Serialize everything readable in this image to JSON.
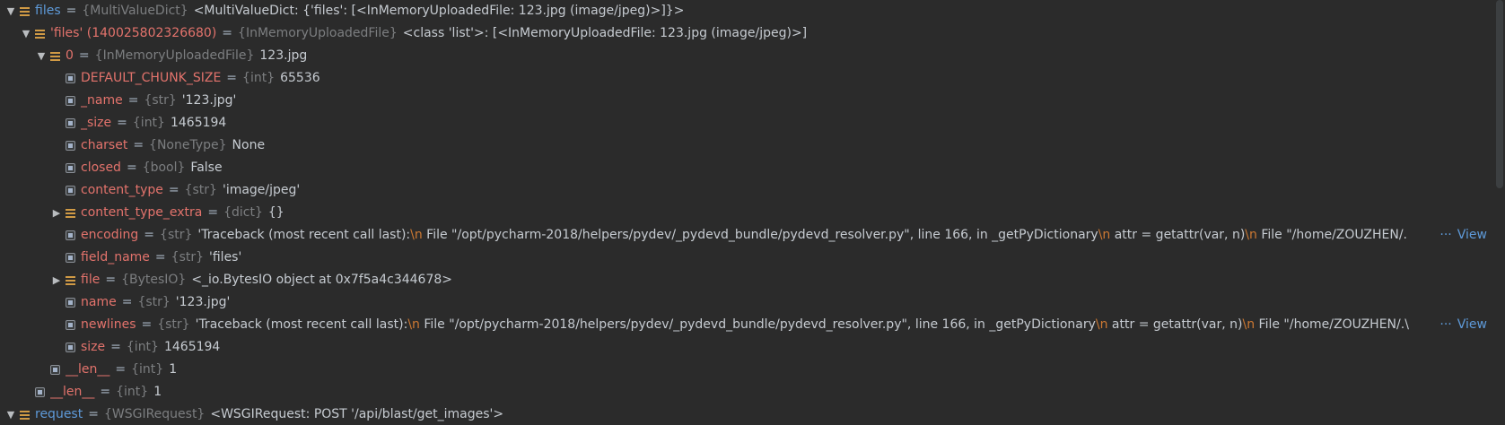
{
  "rows": [
    {
      "level": 0,
      "expanded": "open",
      "icon": "obj",
      "name": "files",
      "top": true,
      "type": "{MultiValueDict}",
      "value": "<MultiValueDict: {'files': [<InMemoryUploadedFile: 123.jpg (image/jpeg)>]}>"
    },
    {
      "level": 1,
      "expanded": "open",
      "icon": "obj",
      "name": "'files' (140025802326680)",
      "top": false,
      "type": "{InMemoryUploadedFile}",
      "value": "<class 'list'>: [<InMemoryUploadedFile: 123.jpg (image/jpeg)>]"
    },
    {
      "level": 2,
      "expanded": "open",
      "icon": "obj",
      "name": "0",
      "top": false,
      "type": "{InMemoryUploadedFile}",
      "value": "123.jpg"
    },
    {
      "level": 3,
      "expanded": "none",
      "icon": "prim",
      "name": "DEFAULT_CHUNK_SIZE",
      "top": false,
      "type": "{int}",
      "value": "65536"
    },
    {
      "level": 3,
      "expanded": "none",
      "icon": "prim",
      "name": "_name",
      "top": false,
      "type": "{str}",
      "value": "'123.jpg'"
    },
    {
      "level": 3,
      "expanded": "none",
      "icon": "prim",
      "name": "_size",
      "top": false,
      "type": "{int}",
      "value": "1465194"
    },
    {
      "level": 3,
      "expanded": "none",
      "icon": "prim",
      "name": "charset",
      "top": false,
      "type": "{NoneType}",
      "value": "None"
    },
    {
      "level": 3,
      "expanded": "none",
      "icon": "prim",
      "name": "closed",
      "top": false,
      "type": "{bool}",
      "value": "False"
    },
    {
      "level": 3,
      "expanded": "none",
      "icon": "prim",
      "name": "content_type",
      "top": false,
      "type": "{str}",
      "value": "'image/jpeg'"
    },
    {
      "level": 3,
      "expanded": "closed",
      "icon": "obj",
      "name": "content_type_extra",
      "top": false,
      "type": "{dict}",
      "value": "{}"
    },
    {
      "level": 3,
      "expanded": "none",
      "icon": "prim",
      "name": "encoding",
      "top": false,
      "type": "{str}",
      "value_parts": [
        "'Traceback (most recent call last):",
        "\\n",
        "  File \"/opt/pycharm-2018/helpers/pydev/_pydevd_bundle/pydevd_resolver.py\", line 166, in _getPyDictionary",
        "\\n",
        "    attr = getattr(var, n)",
        "\\n",
        "  File \"/home/ZOUZHEN/."
      ],
      "more": true
    },
    {
      "level": 3,
      "expanded": "none",
      "icon": "prim",
      "name": "field_name",
      "top": false,
      "type": "{str}",
      "value": "'files'"
    },
    {
      "level": 3,
      "expanded": "closed",
      "icon": "obj",
      "name": "file",
      "top": false,
      "type": "{BytesIO}",
      "value": "<_io.BytesIO object at 0x7f5a4c344678>"
    },
    {
      "level": 3,
      "expanded": "none",
      "icon": "prim",
      "name": "name",
      "top": false,
      "type": "{str}",
      "value": "'123.jpg'"
    },
    {
      "level": 3,
      "expanded": "none",
      "icon": "prim",
      "name": "newlines",
      "top": false,
      "type": "{str}",
      "value_parts": [
        "'Traceback (most recent call last):",
        "\\n",
        "  File \"/opt/pycharm-2018/helpers/pydev/_pydevd_bundle/pydevd_resolver.py\", line 166, in _getPyDictionary",
        "\\n",
        "    attr = getattr(var, n)",
        "\\n",
        "  File \"/home/ZOUZHEN/.\\"
      ],
      "more": true
    },
    {
      "level": 3,
      "expanded": "none",
      "icon": "prim",
      "name": "size",
      "top": false,
      "type": "{int}",
      "value": "1465194"
    },
    {
      "level": 2,
      "expanded": "none",
      "icon": "prim",
      "name": "__len__",
      "top": false,
      "type": "{int}",
      "value": "1"
    },
    {
      "level": 1,
      "expanded": "none",
      "icon": "prim",
      "name": "__len__",
      "top": false,
      "type": "{int}",
      "value": "1"
    },
    {
      "level": 0,
      "expanded": "open",
      "icon": "obj",
      "name": "request",
      "top": true,
      "type": "{WSGIRequest}",
      "value": "<WSGIRequest: POST '/api/blast/get_images'>"
    }
  ],
  "more_link": {
    "dots": "···",
    "label": "View"
  },
  "arrows": {
    "open": "▼",
    "closed": "▶",
    "none": ""
  },
  "colors": {
    "background": "#2b2b2b",
    "name": "#e3736c",
    "top_name": "#5e9ad9",
    "type": "#7c7e80",
    "value": "#c6cbd1",
    "escape": "#cc7832"
  }
}
